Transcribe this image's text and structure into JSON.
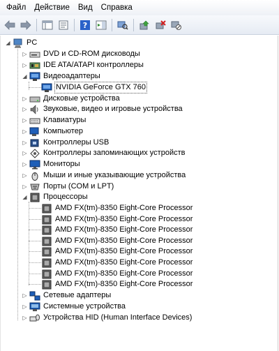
{
  "menu": {
    "items": [
      {
        "label": "Файл"
      },
      {
        "label": "Действие"
      },
      {
        "label": "Вид"
      },
      {
        "label": "Справка"
      }
    ]
  },
  "toolbar": {
    "buttons": [
      "back-icon",
      "forward-icon",
      "console-tree-icon",
      "properties-icon",
      "help-icon",
      "action-pane-icon",
      "scan-hardware-icon",
      "update-driver-icon",
      "uninstall-icon",
      "disable-icon"
    ]
  },
  "tree": {
    "root": {
      "label": "PC",
      "icon": "computer-icon"
    },
    "categories": [
      {
        "label": "DVD и CD-ROM дисководы",
        "icon": "dvd-drive-icon",
        "expanded": false
      },
      {
        "label": "IDE ATA/ATAPI контроллеры",
        "icon": "ide-controller-icon",
        "expanded": false
      },
      {
        "label": "Видеоадаптеры",
        "icon": "display-adapter-icon",
        "expanded": true,
        "children": [
          {
            "label": "NVIDIA GeForce GTX 760",
            "icon": "display-adapter-icon",
            "selected": true
          }
        ]
      },
      {
        "label": "Дисковые устройства",
        "icon": "disk-drive-icon",
        "expanded": false
      },
      {
        "label": "Звуковые, видео и игровые устройства",
        "icon": "speaker-icon",
        "expanded": false
      },
      {
        "label": "Клавиатуры",
        "icon": "keyboard-icon",
        "expanded": false
      },
      {
        "label": "Компьютер",
        "icon": "computer-icon",
        "expanded": false
      },
      {
        "label": "Контроллеры USB",
        "icon": "usb-controller-icon",
        "expanded": false
      },
      {
        "label": "Контроллеры запоминающих устройств",
        "icon": "storage-controller-icon",
        "expanded": false
      },
      {
        "label": "Мониторы",
        "icon": "monitor-icon",
        "expanded": false
      },
      {
        "label": "Мыши и иные указывающие устройства",
        "icon": "mouse-icon",
        "expanded": false
      },
      {
        "label": "Порты (COM и LPT)",
        "icon": "port-icon",
        "expanded": false
      },
      {
        "label": "Процессоры",
        "icon": "processor-icon",
        "expanded": true,
        "children": [
          {
            "label": "AMD FX(tm)-8350 Eight-Core Processor",
            "icon": "processor-icon"
          },
          {
            "label": "AMD FX(tm)-8350 Eight-Core Processor",
            "icon": "processor-icon"
          },
          {
            "label": "AMD FX(tm)-8350 Eight-Core Processor",
            "icon": "processor-icon"
          },
          {
            "label": "AMD FX(tm)-8350 Eight-Core Processor",
            "icon": "processor-icon"
          },
          {
            "label": "AMD FX(tm)-8350 Eight-Core Processor",
            "icon": "processor-icon"
          },
          {
            "label": "AMD FX(tm)-8350 Eight-Core Processor",
            "icon": "processor-icon"
          },
          {
            "label": "AMD FX(tm)-8350 Eight-Core Processor",
            "icon": "processor-icon"
          },
          {
            "label": "AMD FX(tm)-8350 Eight-Core Processor",
            "icon": "processor-icon"
          }
        ]
      },
      {
        "label": "Сетевые адаптеры",
        "icon": "network-adapter-icon",
        "expanded": false
      },
      {
        "label": "Системные устройства",
        "icon": "system-device-icon",
        "expanded": false
      },
      {
        "label": "Устройства HID (Human Interface Devices)",
        "icon": "hid-icon",
        "expanded": false
      }
    ]
  },
  "colors": {
    "accent": "#1f5fb8",
    "tree_line": "#a0a0a0"
  }
}
